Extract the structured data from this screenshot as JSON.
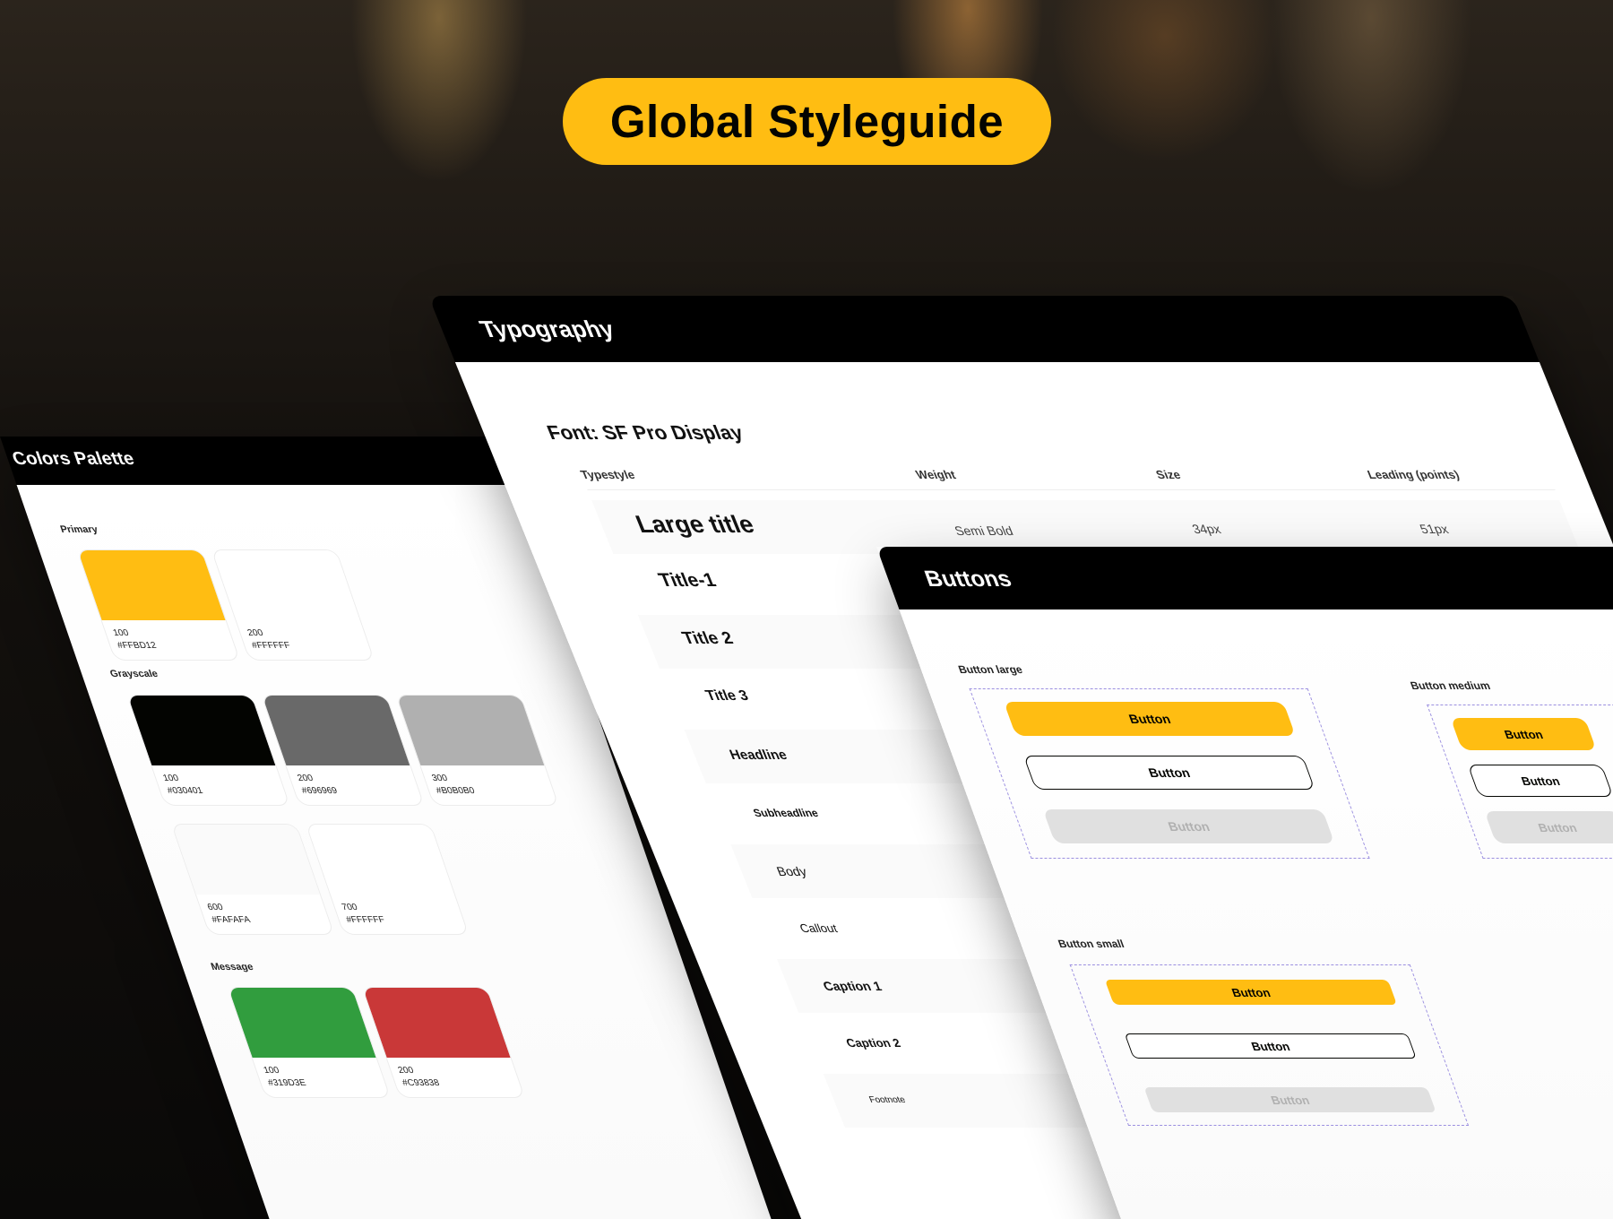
{
  "header": {
    "title": "Global Styleguide"
  },
  "colors_panel": {
    "title": "Colors Palette",
    "sections": {
      "primary": {
        "label": "Primary",
        "swatches": [
          {
            "name": "100",
            "hex": "#FFBD12",
            "color": "#FFBD12"
          },
          {
            "name": "200",
            "hex": "#FFFFFF",
            "color": "#FFFFFF"
          }
        ]
      },
      "grayscale": {
        "label": "Grayscale",
        "swatches": [
          {
            "name": "100",
            "hex": "#030401",
            "color": "#030401"
          },
          {
            "name": "200",
            "hex": "#696969",
            "color": "#696969"
          },
          {
            "name": "300",
            "hex": "#B0B0B0",
            "color": "#B0B0B0"
          },
          {
            "name": "600",
            "hex": "#FAFAFA",
            "color": "#FAFAFA"
          },
          {
            "name": "700",
            "hex": "#FFFFFF",
            "color": "#FFFFFF"
          }
        ]
      },
      "message": {
        "label": "Message",
        "swatches": [
          {
            "name": "100",
            "hex": "#319D3E",
            "color": "#319D3E"
          },
          {
            "name": "200",
            "hex": "#C93838",
            "color": "#C93838"
          }
        ]
      }
    }
  },
  "typography_panel": {
    "title": "Typography",
    "font_label": "Font: SF Pro Display",
    "columns": {
      "typestyle": "Typestyle",
      "weight": "Weight",
      "size": "Size",
      "leading": "Leading (points)"
    },
    "rows": [
      {
        "name": "Large title",
        "weight": "Semi Bold",
        "size": "34px",
        "leading": "51px"
      },
      {
        "name": "Title-1"
      },
      {
        "name": "Title 2"
      },
      {
        "name": "Title 3"
      },
      {
        "name": "Headline"
      },
      {
        "name": "Subheadline"
      },
      {
        "name": "Body"
      },
      {
        "name": "Callout"
      },
      {
        "name": "Caption 1"
      },
      {
        "name": "Caption 2"
      },
      {
        "name": "Footnote"
      }
    ]
  },
  "buttons_panel": {
    "title": "Buttons",
    "groups": {
      "large": {
        "label": "Button large",
        "primary": "Button",
        "outline": "Button",
        "disabled": "Button"
      },
      "medium": {
        "label": "Button medium",
        "primary": "Button",
        "outline": "Button",
        "disabled": "Button"
      },
      "small": {
        "label": "Button small",
        "primary": "Button",
        "outline": "Button",
        "disabled": "Button"
      }
    }
  },
  "theme": {
    "accent": "#FFBD12",
    "dark": "#030401",
    "dashed_border": "#9b8fe0"
  }
}
